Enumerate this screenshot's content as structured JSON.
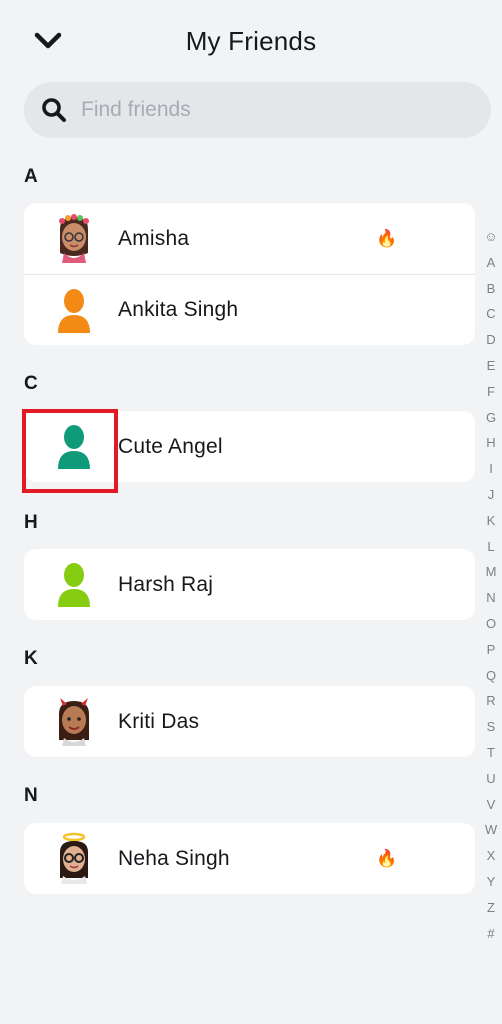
{
  "header": {
    "title": "My Friends"
  },
  "search": {
    "placeholder": "Find friends",
    "value": ""
  },
  "sections": [
    {
      "letter": "A",
      "friends": [
        {
          "name": "Amisha",
          "avatar": "bitmoji-flower-crown-girl",
          "streak": true
        },
        {
          "name": "Ankita Singh",
          "avatar": "default-silhouette",
          "color": "#f28a14",
          "streak": false
        }
      ]
    },
    {
      "letter": "C",
      "friends": [
        {
          "name": "Cute Angel",
          "avatar": "default-silhouette",
          "color": "#0f9a7a",
          "streak": false,
          "highlighted": true
        }
      ]
    },
    {
      "letter": "H",
      "friends": [
        {
          "name": "Harsh Raj",
          "avatar": "default-silhouette",
          "color": "#86cc10",
          "streak": false
        }
      ]
    },
    {
      "letter": "K",
      "friends": [
        {
          "name": "Kriti Das",
          "avatar": "bitmoji-devil-horns-girl",
          "streak": false
        }
      ]
    },
    {
      "letter": "N",
      "friends": [
        {
          "name": "Neha Singh",
          "avatar": "bitmoji-halo-glasses-girl",
          "streak": true
        }
      ]
    }
  ],
  "streak_icon": "🔥",
  "alpha_index": [
    "☺",
    "A",
    "B",
    "C",
    "D",
    "E",
    "F",
    "G",
    "H",
    "I",
    "J",
    "K",
    "L",
    "M",
    "N",
    "O",
    "P",
    "Q",
    "R",
    "S",
    "T",
    "U",
    "V",
    "W",
    "X",
    "Y",
    "Z",
    "#"
  ],
  "colors": {
    "background": "#f2f3f5",
    "card": "#ffffff",
    "search_bg": "#e4e6ea",
    "highlight": "#e01b24"
  }
}
